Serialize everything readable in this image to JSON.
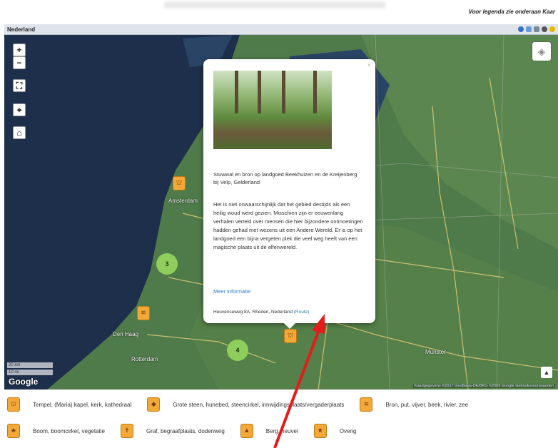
{
  "top_note": "Voor legenda zie onderaan Kaar",
  "map_header": {
    "title": "Nederland"
  },
  "map_controls": {
    "zoom_in": "+",
    "zoom_out": "−",
    "fullscreen": "⛶",
    "locate": "⌖",
    "home": "⌂"
  },
  "cities": [
    "Amsterdam",
    "Den Haag",
    "Rotterdam",
    "Münster"
  ],
  "clusters": [
    "3",
    "4"
  ],
  "popup": {
    "close": "×",
    "title": "Stuwwal en bron op landgoed Beekhuizen en de Kreijenberg bij Velp, Gelderland",
    "body": "Het is niet onwaarschijnlijk dat het gebied destijds als een heilig woud werd gezien. Misschien zijn er eeuwenlang verhalen verteld over mensen die hier bijzondere ontmoetingen hadden gehad met wezens uit een Andere Wereld. Er is op het landgoed een bijna vergeten plek die veel weg heeft van een magische plaats uit de elfenwereld.",
    "more_link": "Meer informatie",
    "address": "Heuvenseweg 8A, Rheden, Nederland",
    "route": "(Route)"
  },
  "scale": {
    "metric": "20 km",
    "imperial": "10 mi"
  },
  "google_logo": "Google",
  "attribution": "Kaartgegevens ©2017 GeoBasis-DE/BKG ©2009 Google Gebruiksvoorwaarden",
  "legend": [
    {
      "icon": "temple-icon",
      "label": "Tempel, (Maria) kapel, kerk, kathedraal"
    },
    {
      "icon": "stone-icon",
      "label": "Grote steen, hunebed, steencirkel, innwijdingsplaats/vergaderplaats"
    },
    {
      "icon": "well-icon",
      "label": "Bron, put, vijver, beek, rivier, zee"
    },
    {
      "icon": "tree-icon",
      "label": "Boom, boomcirkel, vegetatie"
    },
    {
      "icon": "grave-icon",
      "label": "Graf, begraafplaats, dodenweg"
    },
    {
      "icon": "hill-icon",
      "label": "Berg, heuvel"
    },
    {
      "icon": "star-icon",
      "label": "Overig"
    }
  ],
  "colors": {
    "marker": "#f3a93a",
    "cluster": "#8fce5c",
    "arrow": "#e41b1b",
    "link": "#2a7fbf"
  }
}
